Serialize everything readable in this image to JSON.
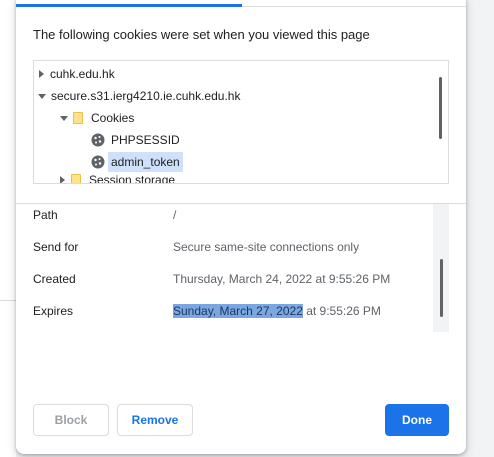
{
  "dialog": {
    "heading": "The following cookies were set when you viewed this page"
  },
  "tree": {
    "items": [
      {
        "label": "cuhk.edu.hk",
        "expander": "collapsed"
      },
      {
        "label": "secure.s31.ierg4210.ie.cuhk.edu.hk",
        "expander": "expanded"
      },
      {
        "label": "Cookies",
        "expander": "expanded",
        "icon": "folder-icon"
      },
      {
        "label": "PHPSESSID",
        "icon": "cookie-icon"
      },
      {
        "label": "admin_token",
        "icon": "cookie-icon",
        "selected": true
      },
      {
        "label": "Session storage",
        "expander": "collapsed",
        "icon": "folder-icon"
      }
    ]
  },
  "details": {
    "rows": [
      {
        "key": "Path",
        "value": "/"
      },
      {
        "key": "Send for",
        "value": "Secure same-site connections only"
      },
      {
        "key": "Created",
        "value": "Thursday, March 24, 2022 at 9:55:26 PM"
      },
      {
        "key": "Expires",
        "value_selected": "Sunday, March 27, 2022",
        "value_rest": " at 9:55:26 PM"
      }
    ]
  },
  "buttons": {
    "block": "Block",
    "remove": "Remove",
    "done": "Done"
  },
  "colors": {
    "accent": "#1a73e8",
    "selection": "#cfe1fa",
    "text_highlight": "#7aa7e0"
  }
}
